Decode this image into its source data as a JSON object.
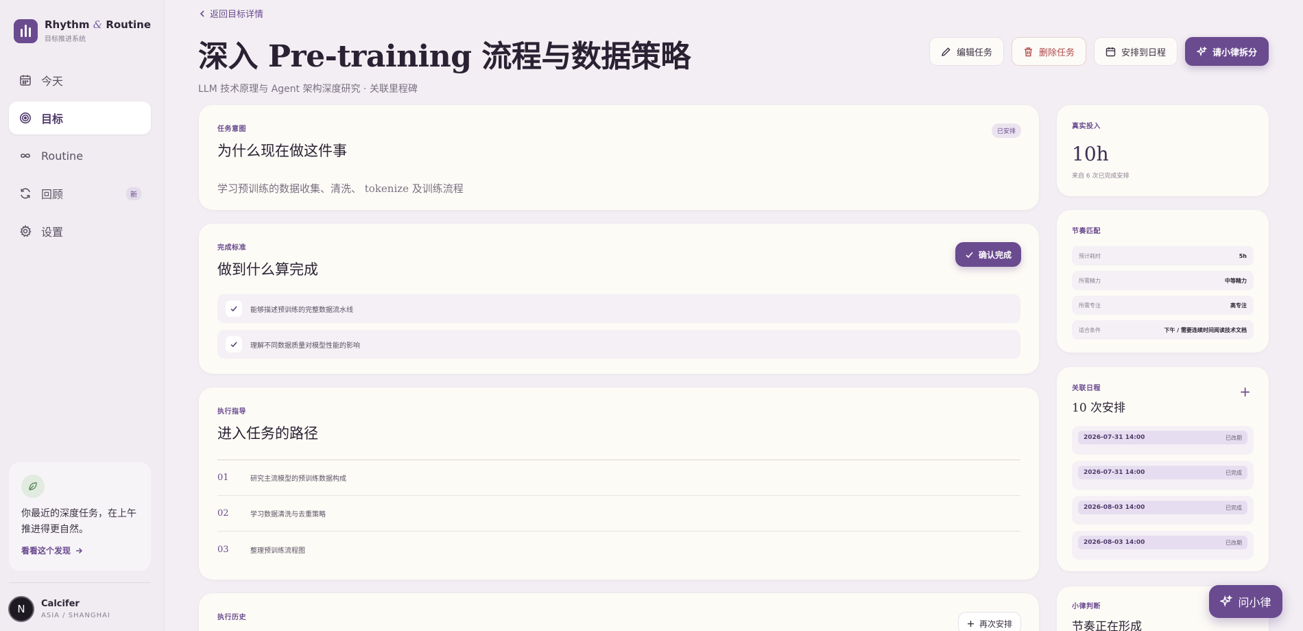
{
  "brand": {
    "name_a": "Rhythm",
    "amp": "&",
    "name_b": "Routine",
    "subtitle": "目标推进系统"
  },
  "nav": [
    {
      "label": "今天",
      "icon": "calendar-icon"
    },
    {
      "label": "目标",
      "icon": "target-icon",
      "active": true
    },
    {
      "label": "Routine",
      "icon": "infinity-icon"
    },
    {
      "label": "回顾",
      "icon": "refresh-icon",
      "badge": "新"
    },
    {
      "label": "设置",
      "icon": "gear-icon"
    }
  ],
  "insight": {
    "text": "你最近的深度任务，在上午推进得更自然。",
    "link": "看看这个发现"
  },
  "user": {
    "initial": "N",
    "name": "Calcifer",
    "location": "ASIA / SHANGHAI"
  },
  "header": {
    "back": "返回目标详情",
    "title": "深入 Pre-training 流程与数据策略",
    "subtitle": "LLM 技术原理与 Agent 架构深度研究 · 关联里程碑"
  },
  "actions": {
    "edit": "编辑任务",
    "delete": "删除任务",
    "schedule": "安排到日程",
    "ask": "请小律拆分"
  },
  "intent": {
    "label": "任务意图",
    "title": "为什么现在做这件事",
    "tag": "已安排",
    "body": "学习预训练的数据收集、清洗、 tokenize 及训练流程"
  },
  "criteria": {
    "label": "完成标准",
    "title": "做到什么算完成",
    "confirm": "确认完成",
    "items": [
      "能够描述预训练的完整数据流水线",
      "理解不同数据质量对模型性能的影响"
    ]
  },
  "guide": {
    "label": "执行指导",
    "title": "进入任务的路径",
    "steps": [
      {
        "num": "01",
        "text": "研究主流模型的预训练数据构成"
      },
      {
        "num": "02",
        "text": "学习数据清洗与去重策略"
      },
      {
        "num": "03",
        "text": "整理预训练流程图"
      }
    ]
  },
  "history": {
    "label": "执行历史",
    "again": "再次安排"
  },
  "invest": {
    "label": "真实投入",
    "value": "10h",
    "note": "来自 6 次已完成安排"
  },
  "rhythm": {
    "label": "节奏匹配",
    "rows": [
      {
        "k": "预计耗时",
        "v": "5h"
      },
      {
        "k": "所需精力",
        "v": "中等精力"
      },
      {
        "k": "所需专注",
        "v": "高专注"
      },
      {
        "k": "适合条件",
        "v": "下午 / 需要连续时间阅读技术文档"
      }
    ]
  },
  "linked": {
    "label": "关联日程",
    "title": "10 次安排",
    "plus": "+",
    "items": [
      {
        "date": "2026-07-31 14:00",
        "status": "已改期"
      },
      {
        "date": "2026-07-31 14:00",
        "status": "已完成"
      },
      {
        "date": "2026-08-03 14:00",
        "status": "已完成"
      },
      {
        "date": "2026-08-03 14:00",
        "status": "已改期"
      }
    ]
  },
  "judge": {
    "label": "小律判断",
    "title": "节奏正在形成"
  },
  "fab": {
    "label": "问小律"
  },
  "colors": {
    "accent": "#6a4b8f",
    "danger": "#b0474b",
    "card": "#fdfbf6",
    "background": "#f2eef3"
  }
}
